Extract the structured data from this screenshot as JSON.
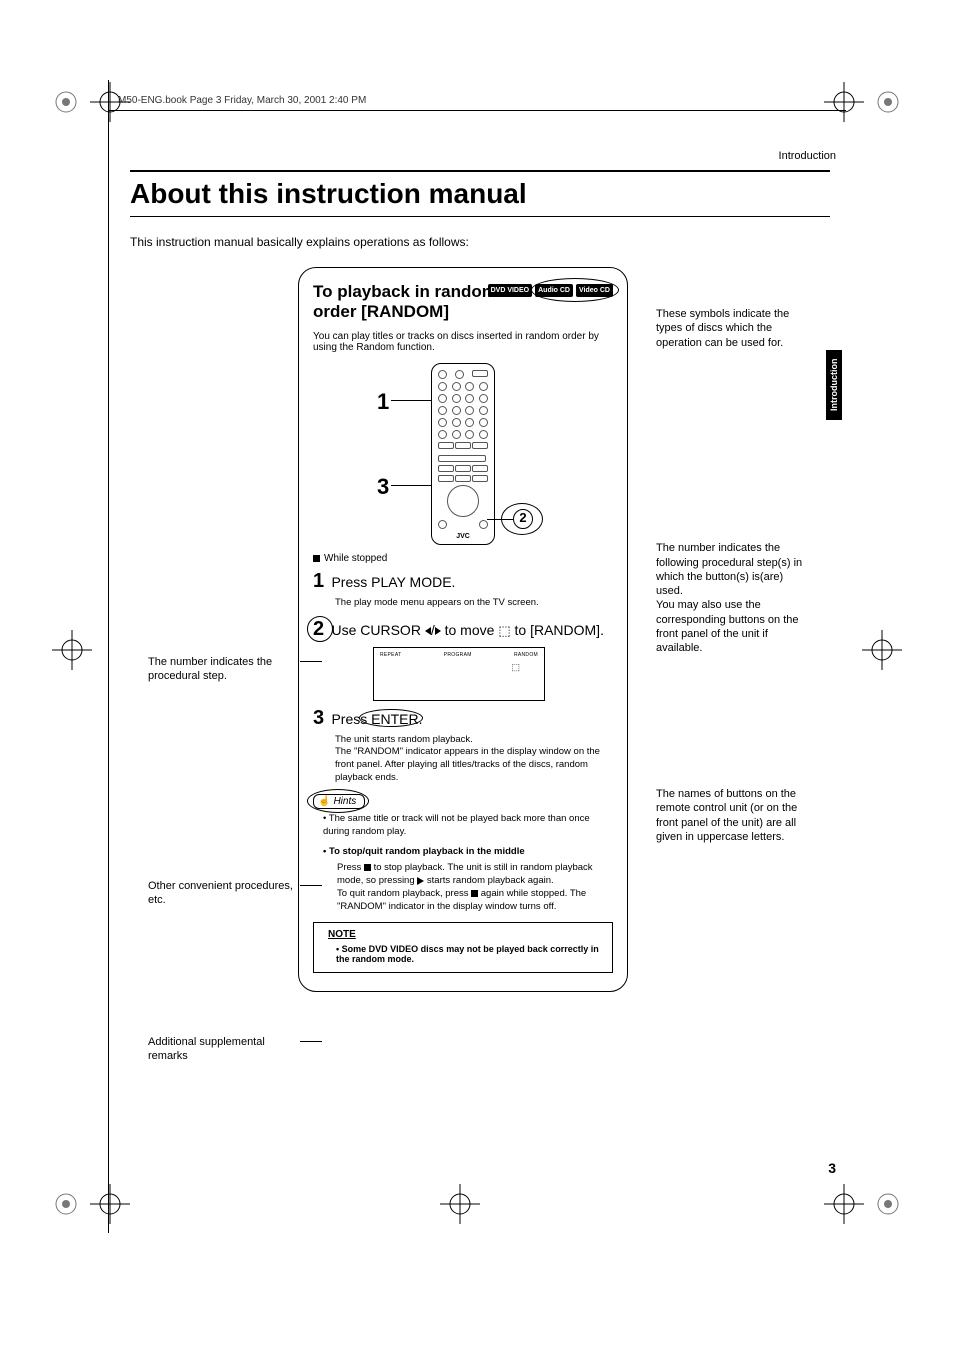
{
  "header": {
    "framemark_text": "M50-ENG.book  Page 3  Friday, March 30, 2001  2:40 PM",
    "section_name": "Introduction",
    "side_tab": "Introduction",
    "page_number": "3"
  },
  "title": "About this instruction manual",
  "intro_sentence": "This instruction manual basically explains operations as follows:",
  "sample": {
    "title": "To playback  in random order [RANDOM]",
    "disc_badges": [
      "DVD VIDEO",
      "Audio CD",
      "Video CD"
    ],
    "intro": "You can play titles or tracks on discs inserted in random order by using the Random function.",
    "remote": {
      "brand": "JVC",
      "markers": {
        "1": "1",
        "3": "3",
        "2": "2"
      }
    },
    "condition": "While stopped",
    "steps": [
      {
        "num": "1",
        "text": "Press PLAY MODE.",
        "detail": "The play mode menu appears on the TV screen."
      },
      {
        "num": "2",
        "text_prefix": "Use CURSOR ",
        "text_suffix": " to move ",
        "text_end": " to [RANDOM].",
        "mini_tabs": [
          "REPEAT",
          "PROGRAM",
          "RANDOM"
        ]
      },
      {
        "num": "3",
        "text": "Press ENTER.",
        "detail": "The unit starts random playback.\nThe \"RANDOM\" indicator appears in the display window on the front panel. After playing all titles/tracks of the discs, random playback ends."
      }
    ],
    "hints_label": "Hints",
    "hints_body": "The same title or track will not be played back more than once during random play.",
    "sub_proc": {
      "title": "To stop/quit random playback in the middle",
      "body_1_pre": "Press ",
      "body_1_mid": " to stop playback. The unit is still in random playback mode, so pressing ",
      "body_1_post": " starts random playback again.",
      "body_2_pre": "To quit random playback, press ",
      "body_2_post": " again while stopped. The \"RANDOM\" indicator in the display window turns off."
    },
    "note": {
      "title": "NOTE",
      "body": "Some DVD VIDEO discs may not be played back correctly in the random mode."
    }
  },
  "callouts": {
    "left": {
      "step_number": "The number indicates the procedural step.",
      "other_conv": "Other convenient procedures, etc.",
      "additional": "Additional supplemental remarks"
    },
    "right": {
      "symbols": "These symbols indicate the types of discs which the operation can be used for.",
      "remote_num": "The number indicates the following procedural step(s) in which the button(s) is(are) used.\nYou may also use the corresponding buttons on the front panel of the unit if available.",
      "button_names": "The names of buttons on the remote control unit (or on the front panel of the unit) are all given in uppercase letters."
    }
  }
}
